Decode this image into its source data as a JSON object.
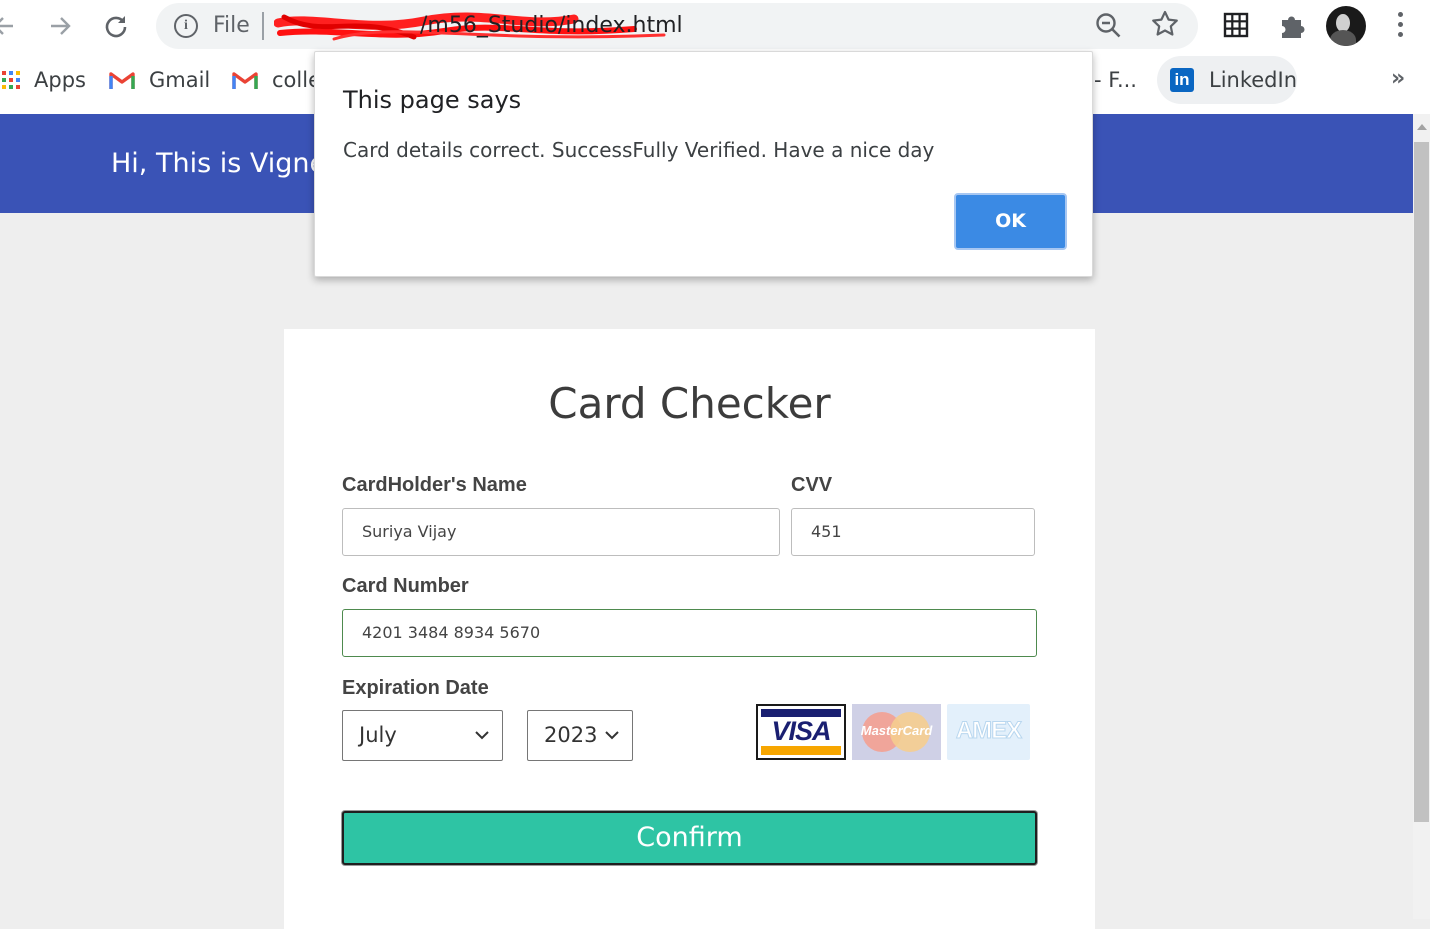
{
  "browser": {
    "address": {
      "scheme_label": "File",
      "url_visible": "/m56_Studio/index.html"
    },
    "icons": {
      "back": "back-arrow-icon",
      "forward": "forward-arrow-icon",
      "reload": "reload-icon",
      "info": "info-icon",
      "zoom": "zoom-out-icon",
      "bookmark": "star-icon",
      "grid": "grid-app-icon",
      "extensions": "puzzle-icon",
      "menu": "kebab-menu-icon"
    }
  },
  "bookmarks": {
    "items": [
      {
        "label": "Apps",
        "icon": "apps-grid-icon"
      },
      {
        "label": "Gmail",
        "icon": "gmail-icon"
      },
      {
        "label": "colle",
        "icon": "gmail-icon"
      },
      {
        "label": "- F...",
        "icon": ""
      },
      {
        "label": "LinkedIn",
        "icon": "linkedin-icon"
      }
    ],
    "overflow": "»"
  },
  "page": {
    "header_title": "Hi, This is Vignesh"
  },
  "dialog": {
    "heading": "This page says",
    "message": "Card details correct. SuccessFully Verified. Have a nice day",
    "ok_label": "OK"
  },
  "card_form": {
    "title": "Card Checker",
    "name_label": "CardHolder's Name",
    "name_value": "Suriya Vijay",
    "cvv_label": "CVV",
    "cvv_value": "451",
    "number_label": "Card Number",
    "number_value": "4201 3484 8934 5670",
    "expiry_label": "Expiration Date",
    "month_selected": "July",
    "year_selected": "2023",
    "card_brands": [
      "VISA",
      "MasterCard",
      "AMEX"
    ],
    "confirm_label": "Confirm"
  },
  "colors": {
    "header_bg": "#3a53b6",
    "confirm_bg": "#2ec4a4",
    "ok_bg": "#3b8ae4",
    "page_bg": "#eeeeee"
  }
}
